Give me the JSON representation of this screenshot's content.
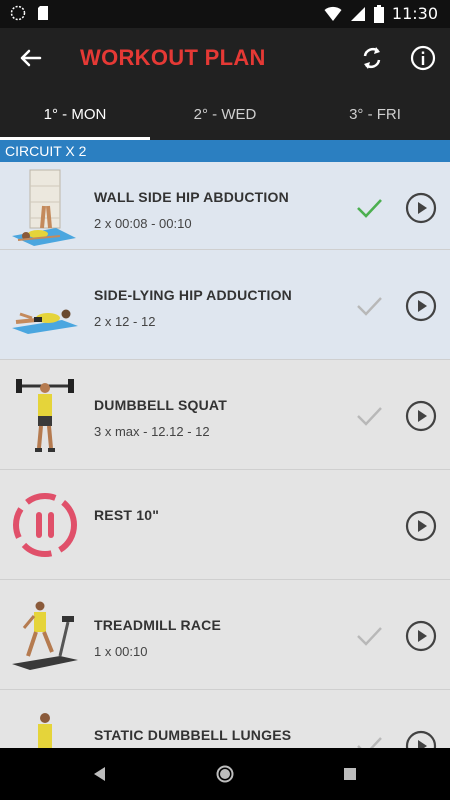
{
  "status_bar": {
    "time": "11:30"
  },
  "toolbar": {
    "title": "WORKOUT PLAN"
  },
  "tabs": [
    {
      "label": "1° - MON"
    },
    {
      "label": "2° - WED"
    },
    {
      "label": "3° - FRI"
    }
  ],
  "circuit": {
    "label": "CIRCUIT X 2"
  },
  "exercises": [
    {
      "name": "WALL SIDE HIP ABDUCTION",
      "detail": "2 x 00:08 - 00:10",
      "checked": true
    },
    {
      "name": "SIDE-LYING HIP ADDUCTION",
      "detail": "2 x 12 - 12",
      "checked": false
    },
    {
      "name": "DUMBBELL SQUAT",
      "detail": "3 x max - 12.12 - 12",
      "checked": false
    },
    {
      "name": "REST 10\"",
      "detail": "",
      "checked": false
    },
    {
      "name": "TREADMILL RACE",
      "detail": "1 x 00:10",
      "checked": false
    },
    {
      "name": "STATIC DUMBBELL LUNGES",
      "detail": "",
      "checked": false
    }
  ],
  "colors": {
    "title_red": "#e53935",
    "circuit_blue": "#2b7fc1",
    "check_done": "#4caf50",
    "check_pending": "#b8b8b8",
    "rest_red": "#e0506a"
  }
}
